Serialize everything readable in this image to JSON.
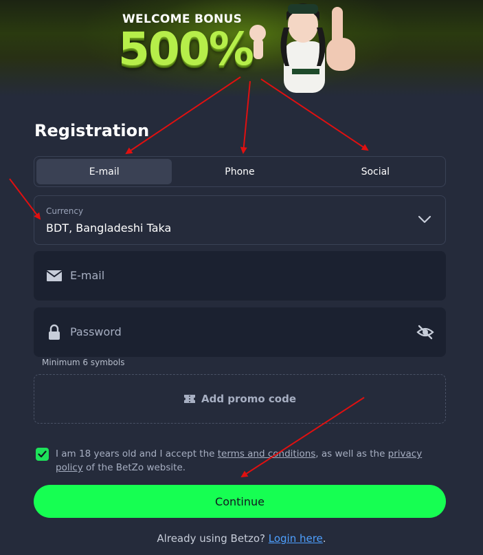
{
  "banner": {
    "title": "WELCOME BONUS",
    "value": "500%"
  },
  "form": {
    "title": "Registration",
    "tabs": [
      {
        "label": "E-mail",
        "active": true
      },
      {
        "label": "Phone",
        "active": false
      },
      {
        "label": "Social",
        "active": false
      }
    ],
    "currency": {
      "label": "Currency",
      "value": "BDT, Bangladeshi Taka"
    },
    "email_placeholder": "E-mail",
    "password_placeholder": "Password",
    "password_hint": "Minimum 6 symbols",
    "promo_label": "Add promo code",
    "agree": {
      "checked": true,
      "text_before": "I am 18 years old and I accept the ",
      "terms_link": "terms and conditions",
      "text_middle": ", as well as the ",
      "privacy_link": "privacy policy",
      "text_after": " of the BetZo website."
    },
    "continue_label": "Continue",
    "login": {
      "prefix": "Already using Betzo? ",
      "link": "Login here",
      "suffix": "."
    }
  },
  "colors": {
    "background": "#252b3b",
    "input_bg": "#1b2130",
    "accent_green": "#16ff52",
    "link_blue": "#4ea0ff",
    "annotation_red": "#e01010"
  }
}
